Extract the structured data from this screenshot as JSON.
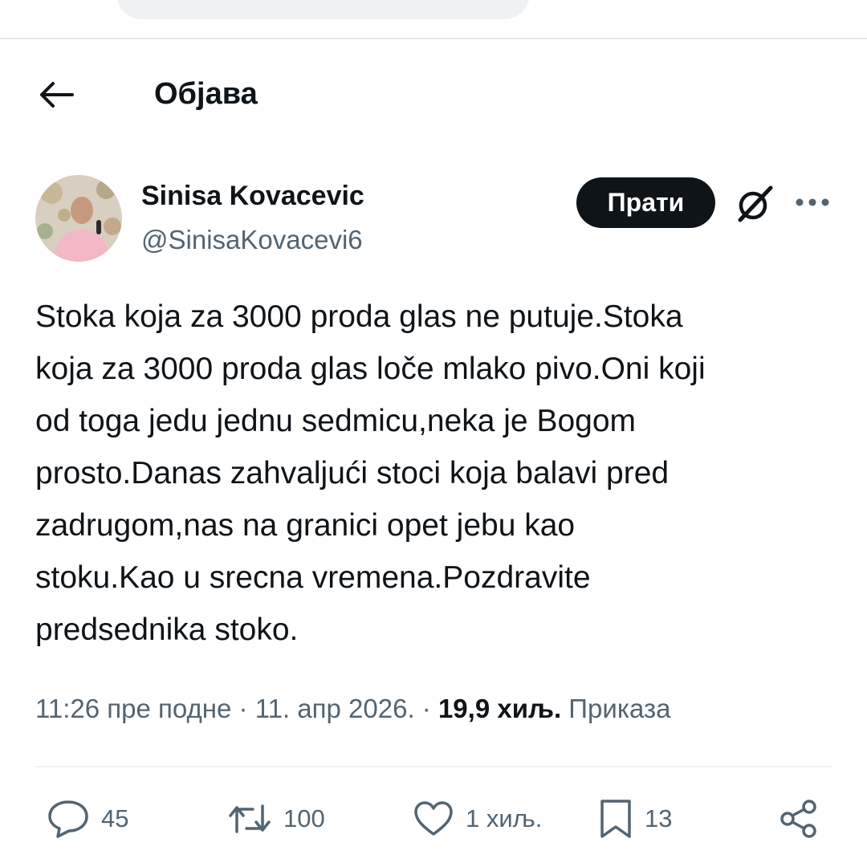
{
  "header": {
    "title": "Објава"
  },
  "author": {
    "name": "Sinisa Kovacevic",
    "handle": "@SinisaKovacevi6",
    "follow_label": "Прати"
  },
  "tweet": {
    "text": "Stoka koja za 3000 proda glas ne putuje.Stoka\nkoja za 3000 proda glas loče mlako pivo.Oni koji\nod toga jedu jednu sedmicu,neka je Bogom\nprosto.Danas zahvaljući  stoci koja balavi pred\nzadrugom,nas na granici opet jebu kao\nstoku.Kao u srecna vremena.Pozdravite\npredsednika stoko.",
    "time": "11:26 пре подне",
    "sep1": " · ",
    "date": "11. апр 2026.",
    "sep2": " · ",
    "views_count": "19,9 хиљ.",
    "views_label": " Приказа"
  },
  "actions": {
    "replies": "45",
    "retweets": "100",
    "likes": "1 хиљ.",
    "bookmarks": "13"
  },
  "icons": {
    "back": "arrow-left-icon",
    "grok": "grok-icon",
    "more": "more-dots-icon",
    "reply": "reply-icon",
    "retweet": "retweet-icon",
    "like": "heart-icon",
    "bookmark": "bookmark-icon",
    "share": "share-icon"
  },
  "colors": {
    "text": "#0f1419",
    "secondary": "#536471",
    "button_bg": "#0f1419",
    "divider": "#eff3f4"
  }
}
